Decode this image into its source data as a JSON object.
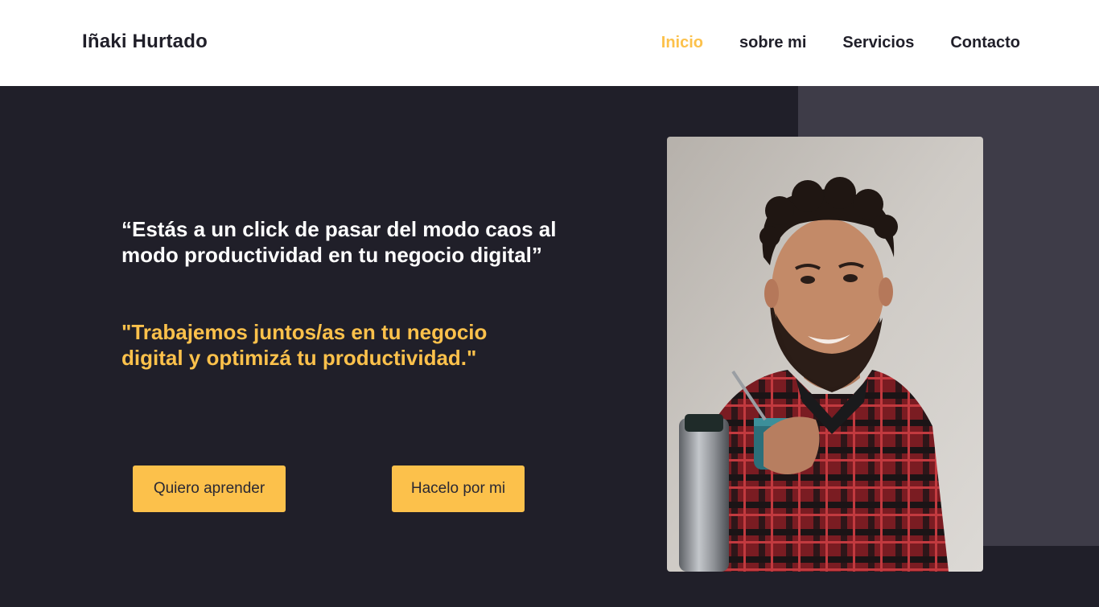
{
  "header": {
    "brand": "Iñaki Hurtado",
    "nav": [
      {
        "label": "Inicio",
        "active": true
      },
      {
        "label": "sobre mi",
        "active": false
      },
      {
        "label": "Servicios",
        "active": false
      },
      {
        "label": "Contacto",
        "active": false
      }
    ]
  },
  "hero": {
    "quote": "“Estás a un click de pasar del modo caos al modo productividad en tu negocio digital”",
    "tagline": "\"Trabajemos juntos/as en tu negocio digital y optimizá tu productividad.\"",
    "buttons": {
      "learn": "Quiero aprender",
      "do_it": "Hacelo por mi"
    }
  },
  "colors": {
    "accent": "#fcc14b",
    "background": "#201f29",
    "panel": "#3e3c48",
    "header_bg": "#ffffff"
  }
}
